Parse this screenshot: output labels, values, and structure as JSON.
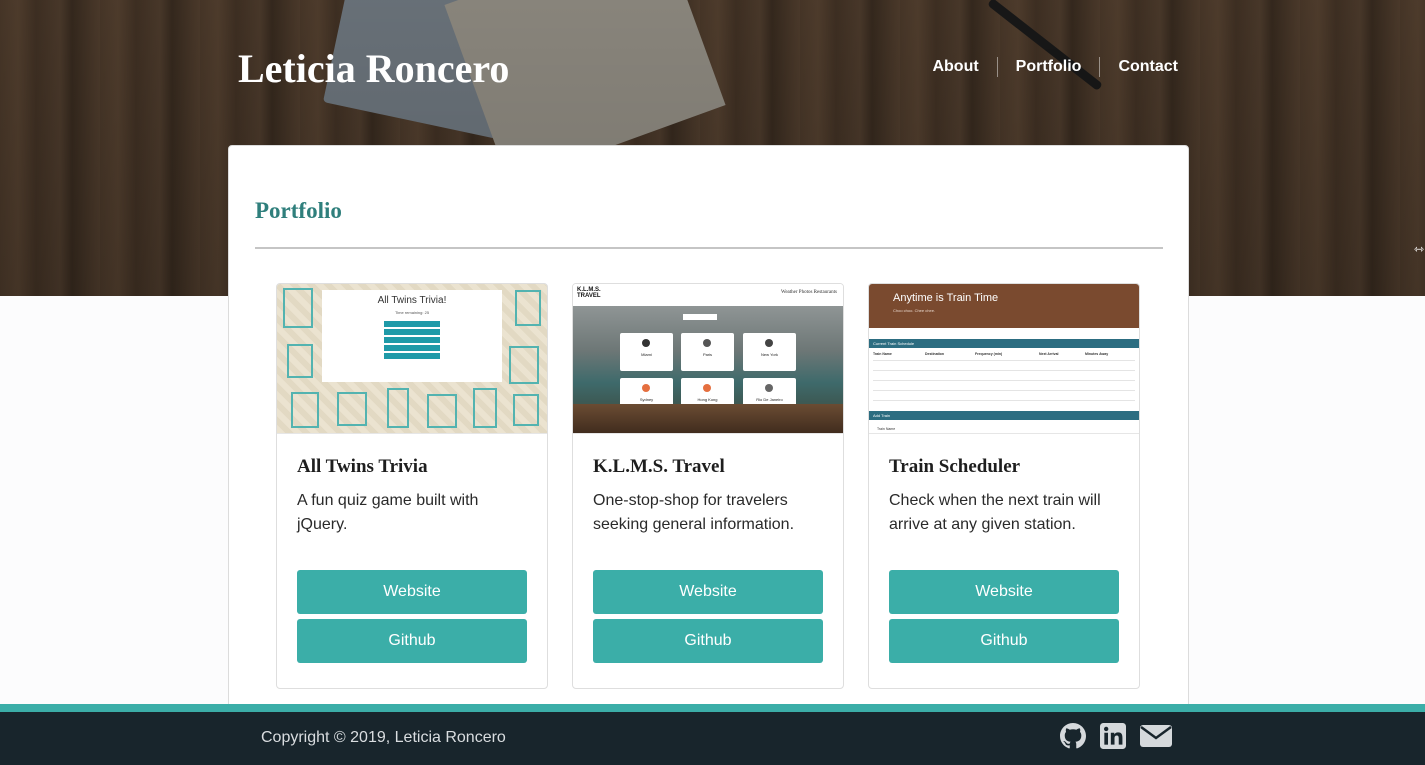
{
  "site": {
    "name": "Leticia Roncero"
  },
  "nav": {
    "items": [
      "About",
      "Portfolio",
      "Contact"
    ]
  },
  "section": {
    "title": "Portfolio"
  },
  "projects": [
    {
      "title": "All Twins Trivia",
      "description": "A fun quiz game built with jQuery.",
      "website_label": "Website",
      "github_label": "Github",
      "thumb": {
        "heading": "All Twins Trivia!",
        "sub": "Time remaining: 25"
      }
    },
    {
      "title": "K.L.M.S. Travel",
      "description": "One-stop-shop for travelers seeking general information.",
      "website_label": "Website",
      "github_label": "Github",
      "thumb": {
        "logo": "K.L.M.S. TRAVEL",
        "links": "Weather  Photos  Restaurants",
        "cities": [
          "Miami",
          "Paris",
          "New York",
          "Sydney",
          "Hong Kong",
          "Rio De Janeiro"
        ]
      }
    },
    {
      "title": "Train Scheduler",
      "description": "Check when the next train will arrive at any given station.",
      "website_label": "Website",
      "github_label": "Github",
      "thumb": {
        "heading": "Anytime is Train Time",
        "sub": "Choo choo. Chee chee.",
        "bar1": "Current Train Schedule",
        "bar2": "Add Train",
        "columns": [
          "Train Name",
          "Destination",
          "Frequency (min)",
          "Next Arrival",
          "Minutes Away"
        ],
        "field": "Train Name"
      }
    }
  ],
  "footer": {
    "copyright": "Copyright © 2019, Leticia Roncero",
    "icons": [
      "github-icon",
      "linkedin-icon",
      "envelope-icon"
    ]
  },
  "colors": {
    "accent": "#3baea8",
    "footer_bg": "#18252c",
    "title_teal": "#2f7f7c",
    "train_banner": "#7a4a2f"
  }
}
